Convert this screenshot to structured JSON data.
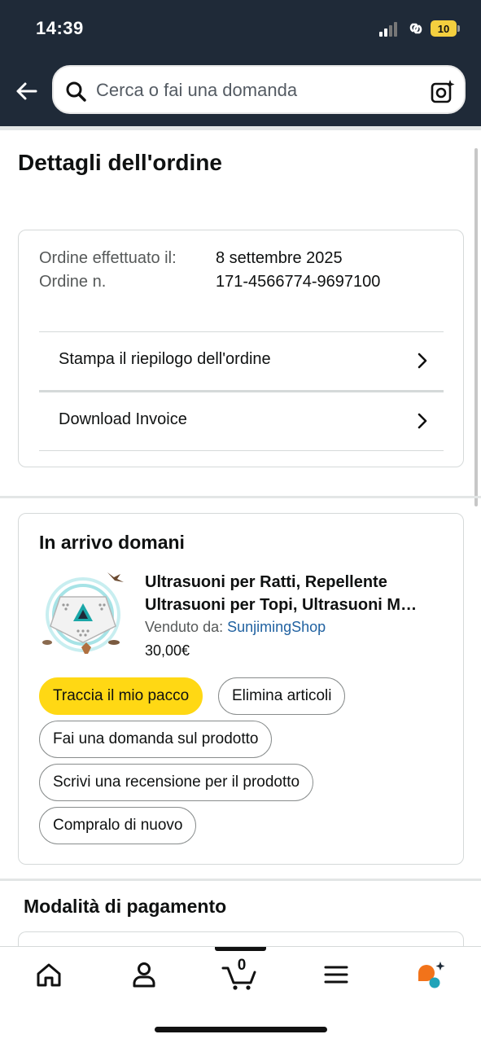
{
  "status_bar": {
    "time": "14:39",
    "battery": "10"
  },
  "search": {
    "placeholder": "Cerca o fai una domanda"
  },
  "page": {
    "title": "Dettagli dell'ordine"
  },
  "order_info": {
    "labels": "Ordine effettuato il:\nOrdine n.",
    "date": "8 settembre 2025",
    "number": "171-4566774-9697100"
  },
  "order_actions": [
    {
      "label": "Stampa il riepilogo dell'ordine"
    },
    {
      "label": "Download Invoice"
    }
  ],
  "shipment": {
    "status": "In arrivo domani",
    "product": {
      "title": "Ultrasuoni per Ratti, Repellente Ultrasuoni per Topi, Ultrasuoni M…",
      "seller_label": "Venduto da:",
      "seller_name": "SunjimingShop",
      "price": "30,00€"
    },
    "buttons": [
      {
        "label": "Traccia il mio pacco"
      },
      {
        "label": "Elimina articoli"
      },
      {
        "label": "Fai una domanda sul prodotto"
      },
      {
        "label": "Scrivi una recensione per il prodotto"
      },
      {
        "label": "Compralo di nuovo"
      }
    ]
  },
  "payment": {
    "title": "Modalità di pagamento"
  },
  "bottom_nav": {
    "items": [
      "home-icon",
      "account-icon",
      "cart-icon",
      "menu-icon",
      "rufus-ai-icon"
    ],
    "cart_count": "0"
  },
  "colors": {
    "header": "#1f2a38",
    "primary_button": "#ffd814",
    "link": "#2162a1",
    "battery": "#f4cf3f"
  }
}
